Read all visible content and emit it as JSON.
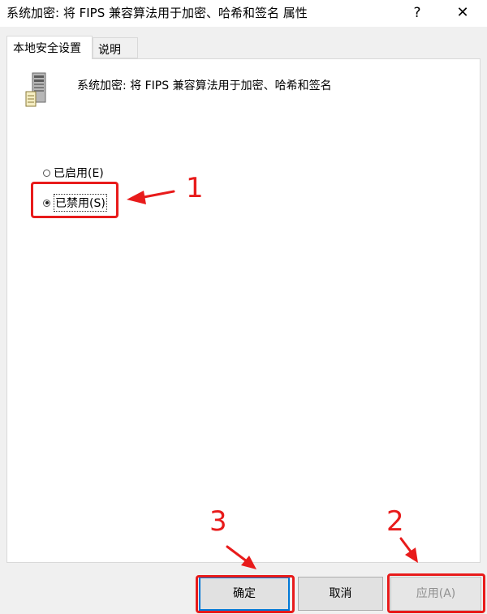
{
  "window": {
    "title": "系统加密: 将 FIPS 兼容算法用于加密、哈希和签名 属性",
    "help_label": "?",
    "close_label": "✕"
  },
  "tabs": [
    {
      "label": "本地安全设置",
      "active": true
    },
    {
      "label": "说明",
      "active": false
    }
  ],
  "policy": {
    "icon": "server-computer-icon",
    "name": "系统加密: 将 FIPS 兼容算法用于加密、哈希和签名"
  },
  "options": [
    {
      "label": "已启用(E)",
      "selected": false
    },
    {
      "label": "已禁用(S)",
      "selected": true
    }
  ],
  "buttons": {
    "ok": "确定",
    "cancel": "取消",
    "apply": "应用(A)"
  },
  "annotations": {
    "color": "#e81b1b",
    "step1": "1",
    "step2": "2",
    "step3": "3"
  }
}
